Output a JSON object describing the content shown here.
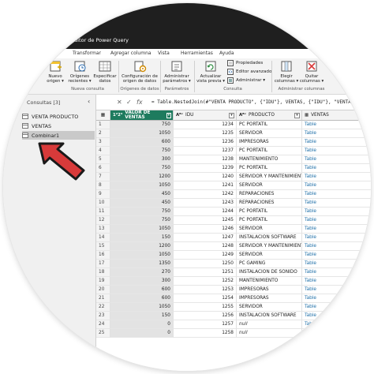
{
  "window": {
    "title": "Editor de Power Query"
  },
  "tabs": [
    "Transformar",
    "Agregar columna",
    "Vista",
    "Herramientas",
    "Ayuda"
  ],
  "ribbon": {
    "buttons": [
      {
        "label1": "Nuevo",
        "label2": "origen ▾"
      },
      {
        "label1": "Orígenes",
        "label2": "recientes ▾"
      },
      {
        "label1": "Especificar",
        "label2": "datos"
      },
      {
        "label1": "Configuración de",
        "label2": "origen de datos"
      },
      {
        "label1": "Administrar",
        "label2": "parámetros ▾"
      },
      {
        "label1": "Actualizar",
        "label2": "vista previa ▾"
      },
      {
        "label1": "Elegir",
        "label2": "columnas ▾"
      },
      {
        "label1": "Quitar",
        "label2": "columnas ▾"
      }
    ],
    "small_buttons": [
      "Propiedades",
      "Editor avanzado",
      "Administrar ▾"
    ],
    "groups": [
      "Nueva consulta",
      "Orígenes de datos",
      "Parámetros",
      "Consulta",
      "Administrar columnas"
    ]
  },
  "queries": {
    "header": "Consultas [3]",
    "collapse": "‹",
    "items": [
      "VENTA PRODUCTO",
      "VENTAS",
      "Combinar1"
    ]
  },
  "formula_bar": {
    "cancel": "✕",
    "confirm": "✓",
    "fx": "fx",
    "formula": "= Table.NestedJoin(#\"VENTA PRODUCTO\", {\"IDU\"}, VENTAS, {\"IDU\"}, \"VENTAS\", Jo"
  },
  "grid": {
    "corner": "▦",
    "columns": [
      {
        "type": "1²2³",
        "name": "VALOR DE VENTAS"
      },
      {
        "type": "Aᴮᶜ",
        "name": "IDU"
      },
      {
        "type": "Aᴮᶜ",
        "name": "PRODUCTO"
      },
      {
        "type": "▦",
        "name": "VENTAS"
      }
    ],
    "rows": [
      [
        "1",
        "750",
        "1234",
        "PC PORTATIL",
        "Table"
      ],
      [
        "2",
        "1050",
        "1235",
        "SERVIDOR",
        "Table"
      ],
      [
        "3",
        "600",
        "1236",
        "IMPRESORAS",
        "Table"
      ],
      [
        "4",
        "750",
        "1237",
        "PC PORTATIL",
        "Table"
      ],
      [
        "5",
        "300",
        "1238",
        "MANTENIMIENTO",
        "Table"
      ],
      [
        "6",
        "750",
        "1239",
        "PC PORTATIL",
        "Table"
      ],
      [
        "7",
        "1200",
        "1240",
        "SERVIDOR Y MANTENIMIENTO",
        "Table"
      ],
      [
        "8",
        "1050",
        "1241",
        "SERVIDOR",
        "Table"
      ],
      [
        "9",
        "450",
        "1242",
        "REPARACIONES",
        "Table"
      ],
      [
        "10",
        "450",
        "1243",
        "REPARACIONES",
        "Table"
      ],
      [
        "11",
        "750",
        "1244",
        "PC PORTATIL",
        "Table"
      ],
      [
        "12",
        "750",
        "1245",
        "PC PORTATIL",
        "Table"
      ],
      [
        "13",
        "1050",
        "1246",
        "SERVIDOR",
        "Table"
      ],
      [
        "14",
        "150",
        "1247",
        "INSTALACION SOFTWARE",
        "Table"
      ],
      [
        "15",
        "1200",
        "1248",
        "SERVIDOR Y MANTENIMIENTO",
        "Table"
      ],
      [
        "16",
        "1050",
        "1249",
        "SERVIDOR",
        "Table"
      ],
      [
        "17",
        "1350",
        "1250",
        "PC GAMING",
        "Table"
      ],
      [
        "18",
        "270",
        "1251",
        "INSTALACION DE SONIDO",
        "Table"
      ],
      [
        "19",
        "300",
        "1252",
        "MANTENIMIENTO",
        "Table"
      ],
      [
        "20",
        "600",
        "1253",
        "IMPRESORAS",
        "Table"
      ],
      [
        "21",
        "600",
        "1254",
        "IMPRESORAS",
        "Table"
      ],
      [
        "22",
        "1050",
        "1255",
        "SERVIDOR",
        "Table"
      ],
      [
        "23",
        "150",
        "1256",
        "INSTALACION SOFTWARE",
        "Table"
      ],
      [
        "24",
        "0",
        "1257",
        "null",
        "Table"
      ],
      [
        "25",
        "0",
        "1258",
        "null",
        "Table"
      ]
    ]
  },
  "colors": {
    "accent": "#1e7b5e",
    "arrow": "#d83a3a",
    "titlebar": "#1f1f1f"
  }
}
